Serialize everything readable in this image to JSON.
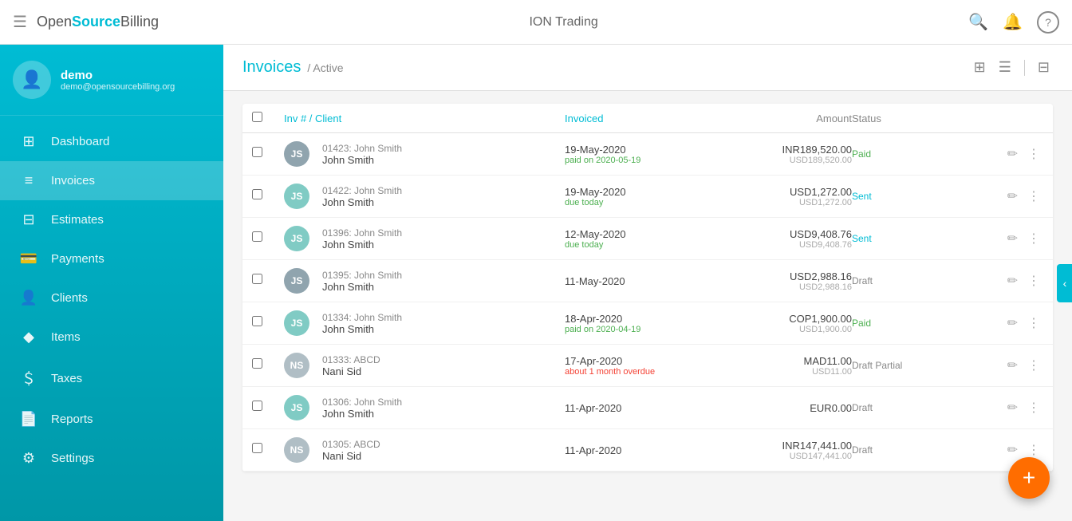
{
  "app": {
    "menu_icon": "☰",
    "logo_open": "Open",
    "logo_source": "Source",
    "logo_billing": "Billing",
    "title": "ION Trading"
  },
  "topbar": {
    "search_icon": "🔍",
    "bell_icon": "🔔",
    "help_icon": "?"
  },
  "sidebar": {
    "user": {
      "name": "demo",
      "email": "demo@opensourcebilling.org",
      "avatar_icon": "👤"
    },
    "items": [
      {
        "id": "dashboard",
        "label": "Dashboard",
        "icon": "⊞"
      },
      {
        "id": "invoices",
        "label": "Invoices",
        "icon": "≡"
      },
      {
        "id": "estimates",
        "label": "Estimates",
        "icon": "⊟"
      },
      {
        "id": "payments",
        "label": "Payments",
        "icon": "💳"
      },
      {
        "id": "clients",
        "label": "Clients",
        "icon": "👤"
      },
      {
        "id": "items",
        "label": "Items",
        "icon": "◆"
      },
      {
        "id": "taxes",
        "label": "Taxes",
        "icon": "＄"
      },
      {
        "id": "reports",
        "label": "Reports",
        "icon": "📄"
      },
      {
        "id": "settings",
        "label": "Settings",
        "icon": "⚙"
      }
    ]
  },
  "page": {
    "title": "Invoices",
    "subtitle": "/ Active"
  },
  "table": {
    "headers": [
      {
        "id": "check",
        "label": ""
      },
      {
        "id": "inv_client",
        "label": "Inv # / Client",
        "style": "cyan"
      },
      {
        "id": "invoiced",
        "label": "Invoiced",
        "style": "cyan"
      },
      {
        "id": "amount",
        "label": "Amount",
        "style": "right"
      },
      {
        "id": "status",
        "label": "Status",
        "style": ""
      }
    ],
    "rows": [
      {
        "id": "01423",
        "avatar_initials": "JS",
        "avatar_color": "#90a4ae",
        "inv_num": "01423: John Smith",
        "client": "John Smith",
        "date": "19-May-2020",
        "date_sub": "paid on 2020-05-19",
        "date_sub_style": "green",
        "amount": "INR189,520.00",
        "amount_sub": "USD189,520.00",
        "status": "Paid",
        "status_style": "paid"
      },
      {
        "id": "01422",
        "avatar_initials": "JS",
        "avatar_color": "#80cbc4",
        "inv_num": "01422: John Smith",
        "client": "John Smith",
        "date": "19-May-2020",
        "date_sub": "due today",
        "date_sub_style": "green",
        "amount": "USD1,272.00",
        "amount_sub": "USD1,272.00",
        "status": "Sent",
        "status_style": "sent"
      },
      {
        "id": "01396",
        "avatar_initials": "JS",
        "avatar_color": "#80cbc4",
        "inv_num": "01396: John Smith",
        "client": "John Smith",
        "date": "12-May-2020",
        "date_sub": "due today",
        "date_sub_style": "green",
        "amount": "USD9,408.76",
        "amount_sub": "USD9,408.76",
        "status": "Sent",
        "status_style": "sent"
      },
      {
        "id": "01395",
        "avatar_initials": "JS",
        "avatar_color": "#90a4ae",
        "inv_num": "01395: John Smith",
        "client": "John Smith",
        "date": "11-May-2020",
        "date_sub": "",
        "date_sub_style": "",
        "amount": "USD2,988.16",
        "amount_sub": "USD2,988.16",
        "status": "Draft",
        "status_style": ""
      },
      {
        "id": "01334",
        "avatar_initials": "JS",
        "avatar_color": "#80cbc4",
        "inv_num": "01334: John Smith",
        "client": "John Smith",
        "date": "18-Apr-2020",
        "date_sub": "paid on 2020-04-19",
        "date_sub_style": "green",
        "amount": "COP1,900.00",
        "amount_sub": "USD1,900.00",
        "status": "Paid",
        "status_style": "paid"
      },
      {
        "id": "01333",
        "avatar_initials": "NS",
        "avatar_color": "#b0bec5",
        "inv_num": "01333: ABCD",
        "client": "Nani Sid",
        "date": "17-Apr-2020",
        "date_sub": "about 1 month overdue",
        "date_sub_style": "red",
        "amount": "MAD11.00",
        "amount_sub": "USD11.00",
        "status": "Draft Partial",
        "status_style": ""
      },
      {
        "id": "01306",
        "avatar_initials": "JS",
        "avatar_color": "#80cbc4",
        "inv_num": "01306: John Smith",
        "client": "John Smith",
        "date": "11-Apr-2020",
        "date_sub": "",
        "date_sub_style": "",
        "amount": "EUR0.00",
        "amount_sub": "",
        "status": "Draft",
        "status_style": ""
      },
      {
        "id": "01305",
        "avatar_initials": "NS",
        "avatar_color": "#b0bec5",
        "inv_num": "01305: ABCD",
        "client": "Nani Sid",
        "date": "11-Apr-2020",
        "date_sub": "",
        "date_sub_style": "",
        "amount": "INR147,441.00",
        "amount_sub": "USD147,441.00",
        "status": "Draft",
        "status_style": ""
      }
    ]
  },
  "fab": {
    "label": "+"
  },
  "icons": {
    "grid_view": "⊞",
    "list_view": "☰",
    "filter": "⊟"
  }
}
